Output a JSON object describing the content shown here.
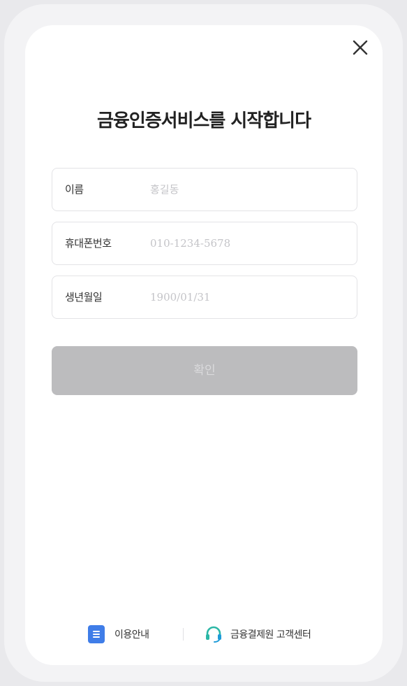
{
  "modal": {
    "title": "금융인증서비스를 시작합니다",
    "close_icon": "close-icon"
  },
  "form": {
    "fields": [
      {
        "label": "이름",
        "placeholder": "홍길동"
      },
      {
        "label": "휴대폰번호",
        "placeholder": "010-1234-5678"
      },
      {
        "label": "생년월일",
        "placeholder": "1900/01/31"
      }
    ],
    "confirm_label": "확인"
  },
  "footer": {
    "guide_label": "이용안내",
    "guide_icon": "document-icon",
    "support_label": "금융결제원 고객센터",
    "support_icon": "headset-icon"
  },
  "colors": {
    "accent_blue": "#3f7de8",
    "support_teal": "#2bb7a6",
    "button_disabled": "#bcbcbe"
  }
}
